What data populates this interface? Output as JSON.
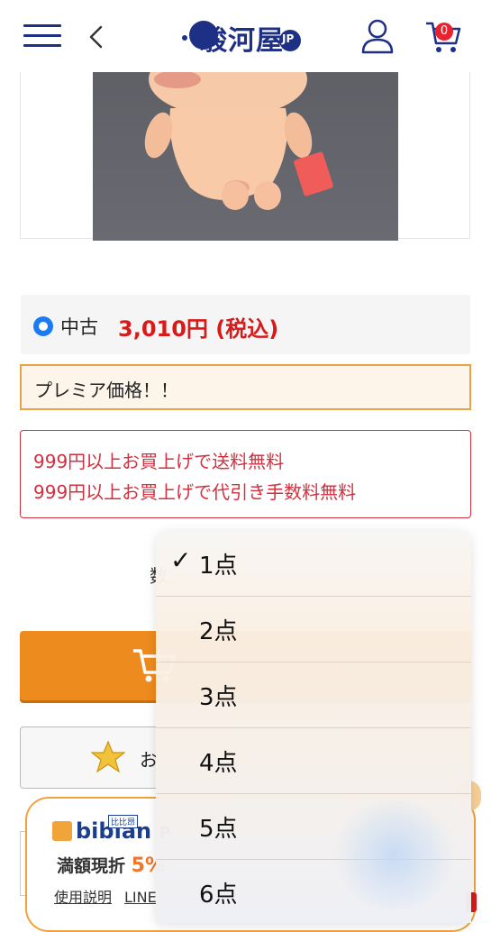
{
  "header": {
    "logo_text": "駿河屋",
    "logo_suffix": "JP",
    "cart_count": "0"
  },
  "product": {
    "condition": "中古",
    "price": "3,010円 (税込)",
    "premium_note": "プレミア価格！！",
    "shipping_free": "999円以上お買上げで送料無料",
    "cod_free": "999円以上お買上げで代引き手数料無料",
    "quantity_label": "数",
    "favorite_label": "お"
  },
  "bibian": {
    "logo": "bibian",
    "logo_kana": "比比昂",
    "logo_tail": "P",
    "cashback_label": "満額現折",
    "cashback_rate": "5%",
    "link_usage": "使用説明",
    "link_line": "LINE"
  },
  "quantity_picker": {
    "selected": "1点",
    "options": [
      "1点",
      "2点",
      "3点",
      "4点",
      "5点",
      "6点"
    ]
  },
  "colors": {
    "brand_navy": "#1e2f86",
    "price_red": "#d71a1a",
    "cart_orange": "#ee8b1e",
    "radio_blue": "#1a7bf5"
  }
}
